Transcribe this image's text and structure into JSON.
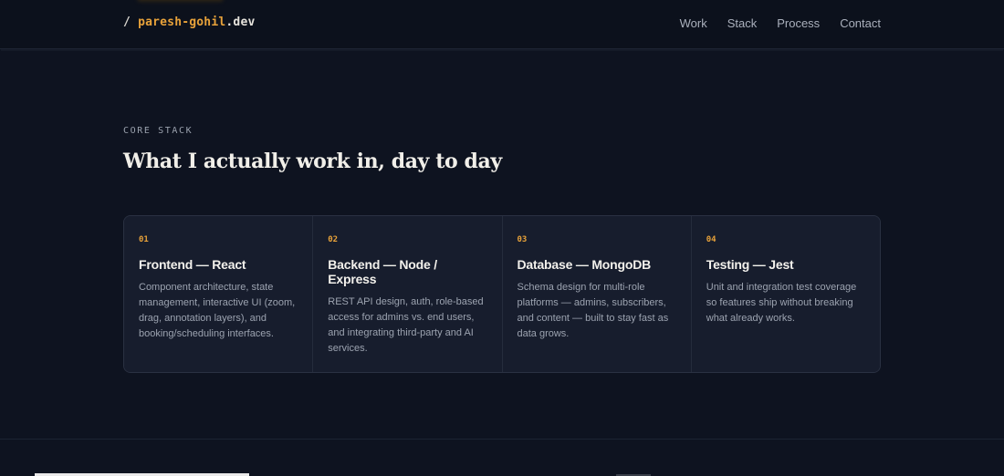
{
  "header": {
    "logo": {
      "slash": "/",
      "name": "paresh-gohil",
      "tld": ".dev"
    },
    "nav": [
      "Work",
      "Stack",
      "Process",
      "Contact"
    ]
  },
  "section": {
    "eyebrow": "CORE STACK",
    "title": "What I actually work in, day to day",
    "cards": [
      {
        "num": "01",
        "title": "Frontend — React",
        "desc": "Component architecture, state management, interactive UI (zoom, drag, annotation layers), and booking/scheduling interfaces."
      },
      {
        "num": "02",
        "title": "Backend — Node / Express",
        "desc": "REST API design, auth, role-based access for admins vs. end users, and integrating third-party and AI services."
      },
      {
        "num": "03",
        "title": "Database — MongoDB",
        "desc": "Schema design for multi-role platforms — admins, subscribers, and content — built to stay fast as data grows."
      },
      {
        "num": "04",
        "title": "Testing — Jest",
        "desc": "Unit and integration test coverage so features ship without breaking what already works."
      }
    ]
  },
  "colors": {
    "background": "#0e1320",
    "accent": "#e8a23a",
    "card": "#171d2d"
  }
}
